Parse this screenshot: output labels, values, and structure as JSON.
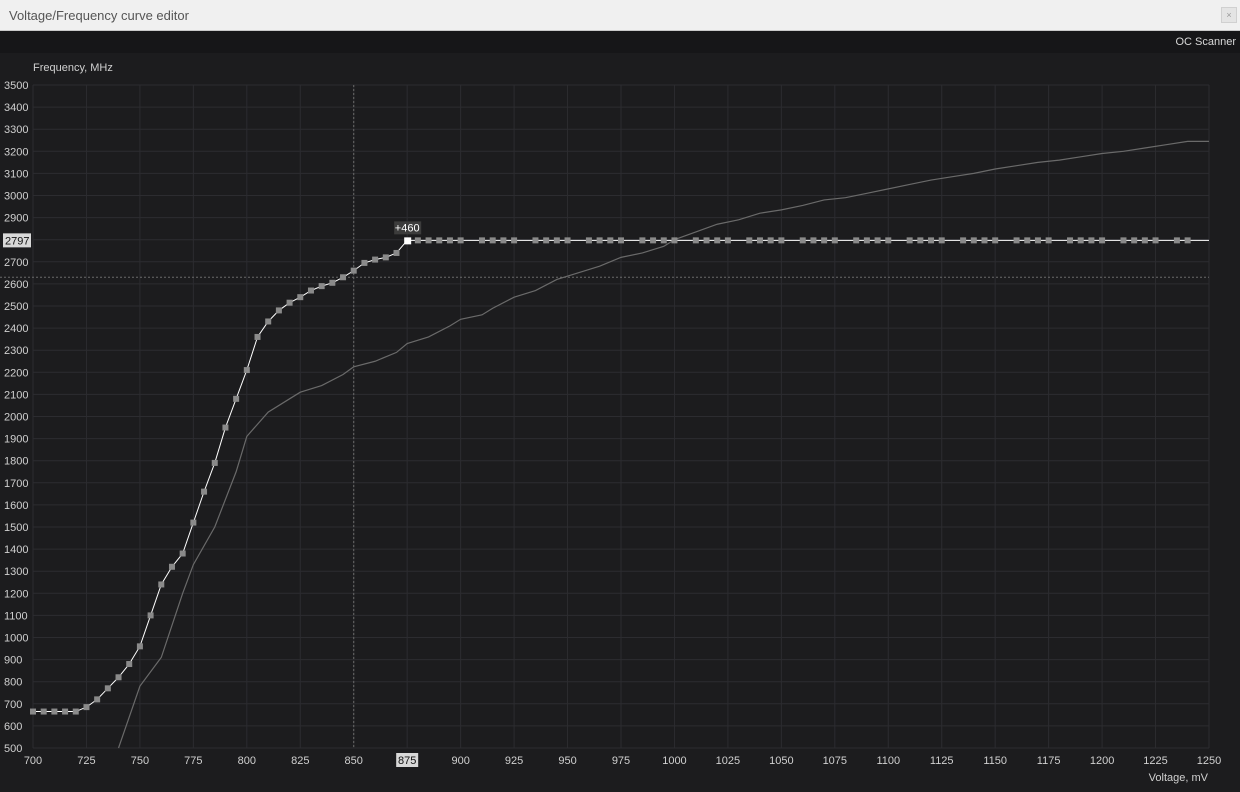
{
  "window": {
    "title": "Voltage/Frequency curve editor",
    "close_glyph": "×"
  },
  "toolbar": {
    "oc_scanner_label": "OC Scanner"
  },
  "colors": {
    "background": "#1c1c1e",
    "grid": "#2c2c30",
    "curve": "#ffffff",
    "default_curve": "#6a6a6a",
    "point": "#8a8a8a"
  },
  "chart_data": {
    "type": "line",
    "xlabel": "Voltage, mV",
    "ylabel": "Frequency, MHz",
    "xlim": [
      700,
      1250
    ],
    "ylim": [
      500,
      3500
    ],
    "x_ticks": [
      700,
      725,
      750,
      775,
      800,
      825,
      850,
      875,
      900,
      925,
      950,
      975,
      1000,
      1025,
      1050,
      1075,
      1100,
      1125,
      1150,
      1175,
      1200,
      1225,
      1250
    ],
    "y_ticks": [
      500,
      600,
      700,
      800,
      900,
      1000,
      1100,
      1200,
      1300,
      1400,
      1500,
      1600,
      1700,
      1800,
      1900,
      2000,
      2100,
      2200,
      2300,
      2400,
      2500,
      2600,
      2700,
      2800,
      2900,
      3000,
      3100,
      3200,
      3300,
      3400,
      3500
    ],
    "selected_point": {
      "voltage": 875,
      "frequency": 2797,
      "offset_label": "+460",
      "voltage_label": "875",
      "frequency_label": "2797"
    },
    "crosshair": {
      "voltage": 850,
      "frequency": 2630
    },
    "series": [
      {
        "values": [
          [
            700,
            665
          ],
          [
            705,
            665
          ],
          [
            710,
            665
          ],
          [
            715,
            665
          ],
          [
            720,
            665
          ],
          [
            725,
            685
          ],
          [
            730,
            720
          ],
          [
            735,
            770
          ],
          [
            740,
            820
          ],
          [
            745,
            880
          ],
          [
            750,
            960
          ],
          [
            755,
            1100
          ],
          [
            760,
            1240
          ],
          [
            765,
            1320
          ],
          [
            770,
            1380
          ],
          [
            775,
            1520
          ],
          [
            780,
            1660
          ],
          [
            785,
            1790
          ],
          [
            790,
            1950
          ],
          [
            795,
            2080
          ],
          [
            800,
            2210
          ],
          [
            805,
            2360
          ],
          [
            810,
            2430
          ],
          [
            815,
            2480
          ],
          [
            820,
            2515
          ],
          [
            825,
            2540
          ],
          [
            830,
            2570
          ],
          [
            835,
            2590
          ],
          [
            840,
            2605
          ],
          [
            845,
            2630
          ],
          [
            850,
            2660
          ],
          [
            855,
            2695
          ],
          [
            860,
            2710
          ],
          [
            865,
            2720
          ],
          [
            870,
            2740
          ],
          [
            875,
            2797
          ],
          [
            880,
            2797
          ],
          [
            885,
            2797
          ],
          [
            890,
            2797
          ],
          [
            895,
            2797
          ],
          [
            900,
            2797
          ],
          [
            910,
            2797
          ],
          [
            915,
            2797
          ],
          [
            920,
            2797
          ],
          [
            925,
            2797
          ],
          [
            935,
            2797
          ],
          [
            940,
            2797
          ],
          [
            945,
            2797
          ],
          [
            950,
            2797
          ],
          [
            960,
            2797
          ],
          [
            965,
            2797
          ],
          [
            970,
            2797
          ],
          [
            975,
            2797
          ],
          [
            985,
            2797
          ],
          [
            990,
            2797
          ],
          [
            995,
            2797
          ],
          [
            1000,
            2797
          ],
          [
            1010,
            2797
          ],
          [
            1015,
            2797
          ],
          [
            1020,
            2797
          ],
          [
            1025,
            2797
          ],
          [
            1035,
            2797
          ],
          [
            1040,
            2797
          ],
          [
            1045,
            2797
          ],
          [
            1050,
            2797
          ],
          [
            1060,
            2797
          ],
          [
            1065,
            2797
          ],
          [
            1070,
            2797
          ],
          [
            1075,
            2797
          ],
          [
            1085,
            2797
          ],
          [
            1090,
            2797
          ],
          [
            1095,
            2797
          ],
          [
            1100,
            2797
          ],
          [
            1110,
            2797
          ],
          [
            1115,
            2797
          ],
          [
            1120,
            2797
          ],
          [
            1125,
            2797
          ],
          [
            1135,
            2797
          ],
          [
            1140,
            2797
          ],
          [
            1145,
            2797
          ],
          [
            1150,
            2797
          ],
          [
            1160,
            2797
          ],
          [
            1165,
            2797
          ],
          [
            1170,
            2797
          ],
          [
            1175,
            2797
          ],
          [
            1185,
            2797
          ],
          [
            1190,
            2797
          ],
          [
            1195,
            2797
          ],
          [
            1200,
            2797
          ],
          [
            1210,
            2797
          ],
          [
            1215,
            2797
          ],
          [
            1220,
            2797
          ],
          [
            1225,
            2797
          ],
          [
            1235,
            2797
          ],
          [
            1240,
            2797
          ],
          [
            1250,
            2797
          ]
        ]
      },
      {
        "values": [
          [
            740,
            500
          ],
          [
            750,
            780
          ],
          [
            760,
            910
          ],
          [
            770,
            1200
          ],
          [
            775,
            1330
          ],
          [
            785,
            1500
          ],
          [
            795,
            1750
          ],
          [
            800,
            1910
          ],
          [
            810,
            2020
          ],
          [
            820,
            2080
          ],
          [
            825,
            2110
          ],
          [
            835,
            2140
          ],
          [
            845,
            2190
          ],
          [
            850,
            2225
          ],
          [
            860,
            2250
          ],
          [
            870,
            2290
          ],
          [
            875,
            2330
          ],
          [
            885,
            2360
          ],
          [
            895,
            2410
          ],
          [
            900,
            2440
          ],
          [
            910,
            2460
          ],
          [
            915,
            2490
          ],
          [
            925,
            2540
          ],
          [
            935,
            2570
          ],
          [
            945,
            2620
          ],
          [
            955,
            2650
          ],
          [
            965,
            2680
          ],
          [
            975,
            2720
          ],
          [
            985,
            2740
          ],
          [
            995,
            2770
          ],
          [
            1000,
            2800
          ],
          [
            1010,
            2835
          ],
          [
            1020,
            2870
          ],
          [
            1030,
            2890
          ],
          [
            1040,
            2920
          ],
          [
            1050,
            2935
          ],
          [
            1060,
            2955
          ],
          [
            1070,
            2980
          ],
          [
            1080,
            2990
          ],
          [
            1090,
            3010
          ],
          [
            1100,
            3030
          ],
          [
            1110,
            3050
          ],
          [
            1120,
            3070
          ],
          [
            1130,
            3085
          ],
          [
            1140,
            3100
          ],
          [
            1150,
            3120
          ],
          [
            1160,
            3135
          ],
          [
            1170,
            3150
          ],
          [
            1180,
            3160
          ],
          [
            1190,
            3175
          ],
          [
            1200,
            3190
          ],
          [
            1210,
            3200
          ],
          [
            1220,
            3215
          ],
          [
            1230,
            3230
          ],
          [
            1240,
            3245
          ],
          [
            1250,
            3245
          ]
        ]
      }
    ]
  }
}
